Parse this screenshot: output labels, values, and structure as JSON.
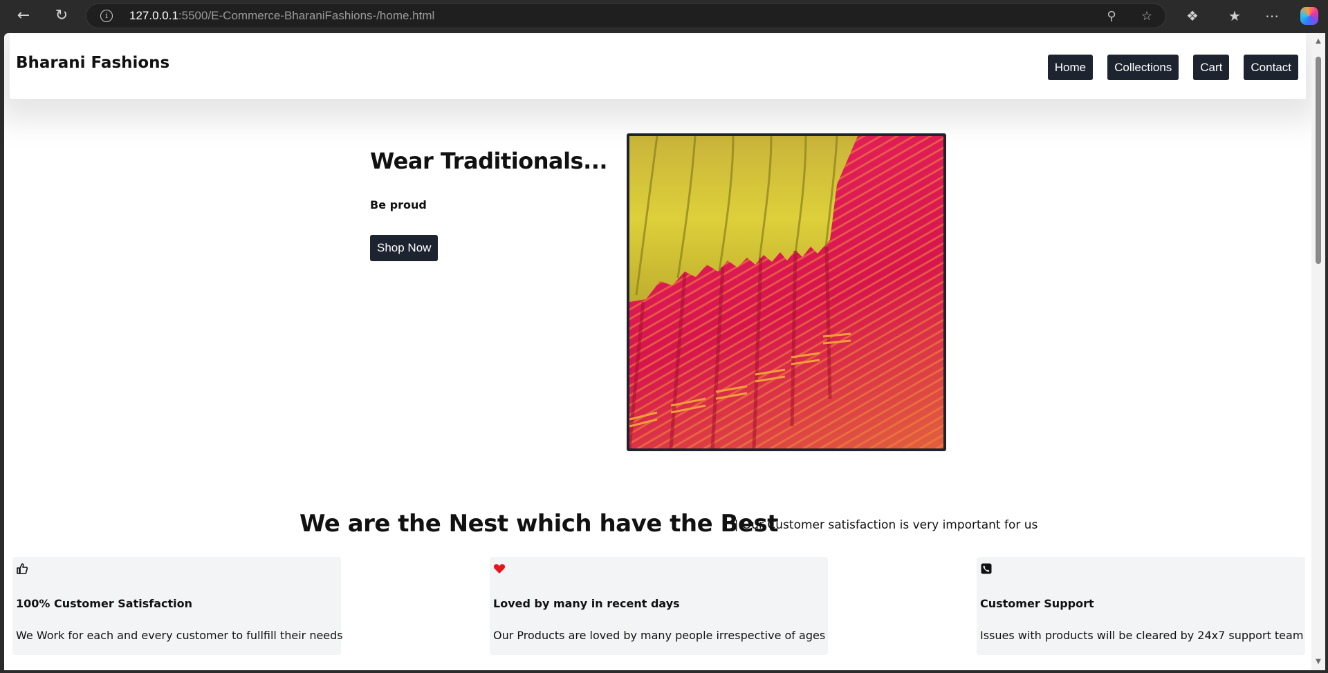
{
  "browser": {
    "url_host": "127.0.0.1",
    "url_path": ":5500/E-Commerce-BharaniFashions-/home.html"
  },
  "header": {
    "brand": "Bharani Fashions",
    "nav": [
      "Home",
      "Collections",
      "Cart",
      "Contact"
    ]
  },
  "hero": {
    "title": "Wear Traditionals...",
    "subtitle": "Be proud",
    "button": "Shop Now"
  },
  "section": {
    "title": "We are the Nest which have the Best",
    "tagline": "|| Our Customer satisfaction is very important for us"
  },
  "features": [
    {
      "icon": "thumbs-up-icon",
      "title": "100% Customer Satisfaction",
      "text": "We Work for each and every customer to fullfill their needs"
    },
    {
      "icon": "heart-icon",
      "title": "Loved by many in recent days",
      "text": "Our Products are loved by many people irrespective of ages"
    },
    {
      "icon": "phone-icon",
      "title": "Customer Support",
      "text": "Issues with products will be cleared by 24x7 support team"
    }
  ],
  "colors": {
    "button_bg": "#1d2430",
    "card_bg": "#f3f4f6",
    "heart": "#e8141b"
  }
}
